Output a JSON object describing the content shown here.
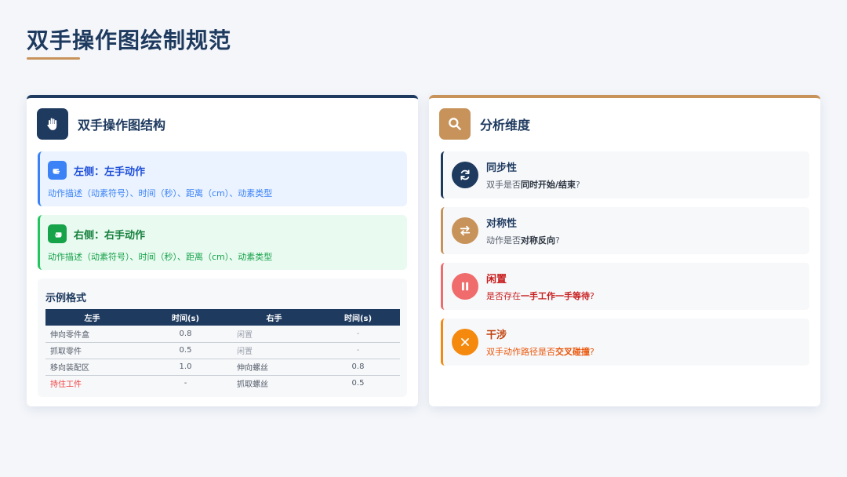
{
  "page": {
    "title": "双手操作图绘制规范"
  },
  "colors": {
    "navy": "#1e3a5f",
    "tan": "#c8935a",
    "blue": "#3b82f6",
    "green": "#16a34a",
    "red": "#f06b6b",
    "orange": "#f5890e"
  },
  "structure": {
    "title": "双手操作图结构",
    "icon": "hand-icon",
    "left": {
      "label": "左侧：左手动作",
      "desc": "动作描述（动素符号）、时间（秒）、距离（cm）、动素类型",
      "icon": "left-hand-point-icon"
    },
    "right": {
      "label": "右侧：右手动作",
      "desc": "动作描述（动素符号）、时间（秒）、距离（cm）、动素类型",
      "icon": "right-hand-point-icon"
    },
    "example": {
      "title": "示例格式",
      "headers": [
        "左手",
        "时间(s)",
        "右手",
        "时间(s)"
      ],
      "rows": [
        [
          "伸向零件盒",
          "0.8",
          "闲置",
          "-"
        ],
        [
          "抓取零件",
          "0.5",
          "闲置",
          "-"
        ],
        [
          "移向装配区",
          "1.0",
          "伸向螺丝",
          "0.8"
        ],
        [
          "持住工件",
          "-",
          "抓取螺丝",
          "0.5"
        ]
      ]
    }
  },
  "analysis": {
    "title": "分析维度",
    "icon": "search-icon",
    "items": [
      {
        "title": "同步性",
        "desc_pre": "双手是否",
        "desc_bold": "同时开始/结束",
        "desc_post": "?",
        "icon": "sync-icon"
      },
      {
        "title": "对称性",
        "desc_pre": "动作是否",
        "desc_bold": "对称反向",
        "desc_post": "?",
        "icon": "swap-icon"
      },
      {
        "title": "闲置",
        "desc_pre": "是否存在",
        "desc_bold": "一手工作一手等待",
        "desc_post": "?",
        "icon": "pause-icon"
      },
      {
        "title": "干涉",
        "desc_pre": "双手动作路径是否",
        "desc_bold": "交叉碰撞",
        "desc_post": "?",
        "icon": "close-icon"
      }
    ]
  }
}
